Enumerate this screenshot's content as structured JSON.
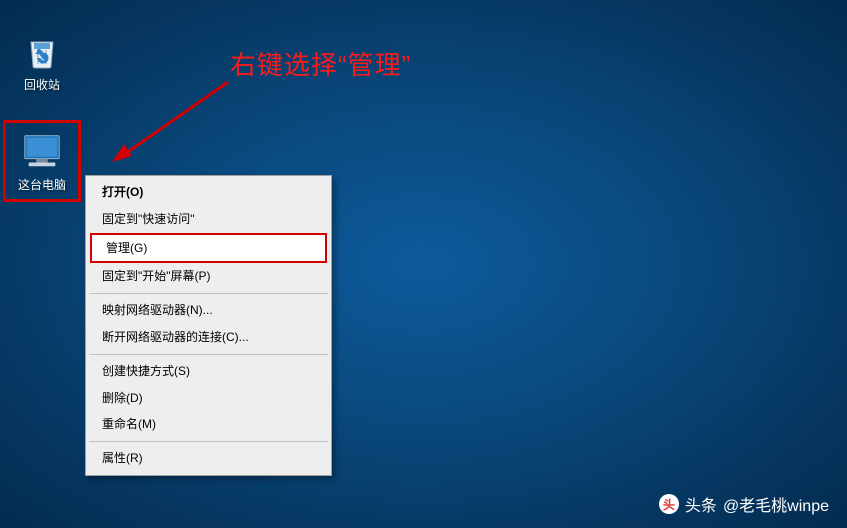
{
  "desktop": {
    "recycle_bin_label": "回收站",
    "this_pc_label": "这台电脑"
  },
  "annotation": {
    "text": "右键选择“管理”"
  },
  "context_menu": {
    "open": "打开(O)",
    "pin_quick_access": "固定到\"快速访问\"",
    "manage": "管理(G)",
    "pin_start": "固定到\"开始\"屏幕(P)",
    "map_drive": "映射网络驱动器(N)...",
    "disconnect_drive": "断开网络驱动器的连接(C)...",
    "create_shortcut": "创建快捷方式(S)",
    "delete": "删除(D)",
    "rename": "重命名(M)",
    "properties": "属性(R)"
  },
  "watermark": {
    "prefix": "头条",
    "handle": "@老毛桃winpe"
  }
}
